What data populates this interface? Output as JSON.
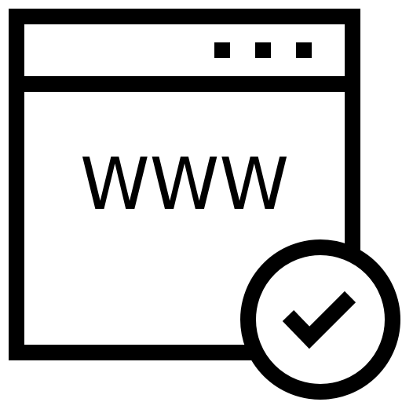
{
  "icon": {
    "name": "web-verified-icon",
    "text": "WWW",
    "color": "#000000",
    "background": "#ffffff",
    "parts": {
      "window": "browser-window-icon",
      "dots": "window-dots-icon",
      "badge": "check-circle-icon",
      "check": "checkmark-icon"
    }
  }
}
